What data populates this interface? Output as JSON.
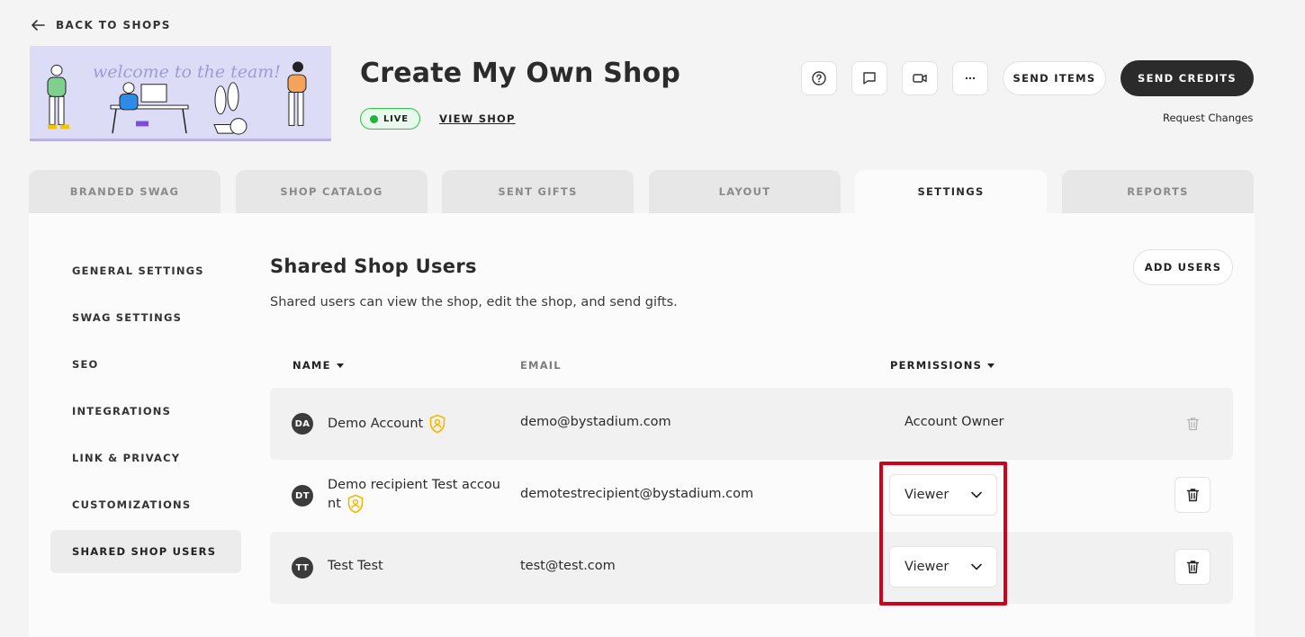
{
  "nav": {
    "back_label": "BACK TO SHOPS"
  },
  "banner": {
    "text": "welcome to the team!"
  },
  "shop": {
    "title": "Create My Own Shop",
    "status": "LIVE",
    "view_shop_label": "VIEW SHOP"
  },
  "header_actions": {
    "icons": [
      "help-icon",
      "comment-icon",
      "video-icon",
      "more-icon"
    ],
    "send_items_label": "SEND ITEMS",
    "send_credits_label": "SEND CREDITS",
    "request_changes_label": "Request Changes"
  },
  "tabs": [
    {
      "label": "BRANDED SWAG",
      "active": false
    },
    {
      "label": "SHOP CATALOG",
      "active": false
    },
    {
      "label": "SENT GIFTS",
      "active": false
    },
    {
      "label": "LAYOUT",
      "active": false
    },
    {
      "label": "SETTINGS",
      "active": true
    },
    {
      "label": "REPORTS",
      "active": false
    }
  ],
  "sidebar": {
    "items": [
      {
        "label": "GENERAL SETTINGS",
        "active": false
      },
      {
        "label": "SWAG SETTINGS",
        "active": false
      },
      {
        "label": "SEO",
        "active": false
      },
      {
        "label": "INTEGRATIONS",
        "active": false
      },
      {
        "label": "LINK & PRIVACY",
        "active": false
      },
      {
        "label": "CUSTOMIZATIONS",
        "active": false
      },
      {
        "label": "SHARED SHOP USERS",
        "active": true
      }
    ]
  },
  "section": {
    "title": "Shared Shop Users",
    "description": "Shared users can view the shop, edit the shop, and send gifts.",
    "add_users_label": "ADD USERS"
  },
  "table": {
    "columns": {
      "name": "NAME",
      "email": "EMAIL",
      "permissions": "PERMISSIONS"
    },
    "rows": [
      {
        "initials": "DA",
        "name": "Demo Account",
        "email": "demo@bystadium.com",
        "permission": "Account Owner",
        "admin_badge": true,
        "editable": false
      },
      {
        "initials": "DT",
        "name_line1": "Demo recipient Test accou",
        "name_line2": "nt",
        "email": "demotestrecipient@bystadium.com",
        "permission": "Viewer",
        "admin_badge": true,
        "editable": true
      },
      {
        "initials": "TT",
        "name": "Test Test",
        "email": "test@test.com",
        "permission": "Viewer",
        "admin_badge": false,
        "editable": true
      }
    ]
  },
  "colors": {
    "accent_dark": "#2b2b2b",
    "live_green": "#1fb33a",
    "badge_yellow": "#f5b800",
    "highlight_red": "#d0021b"
  }
}
